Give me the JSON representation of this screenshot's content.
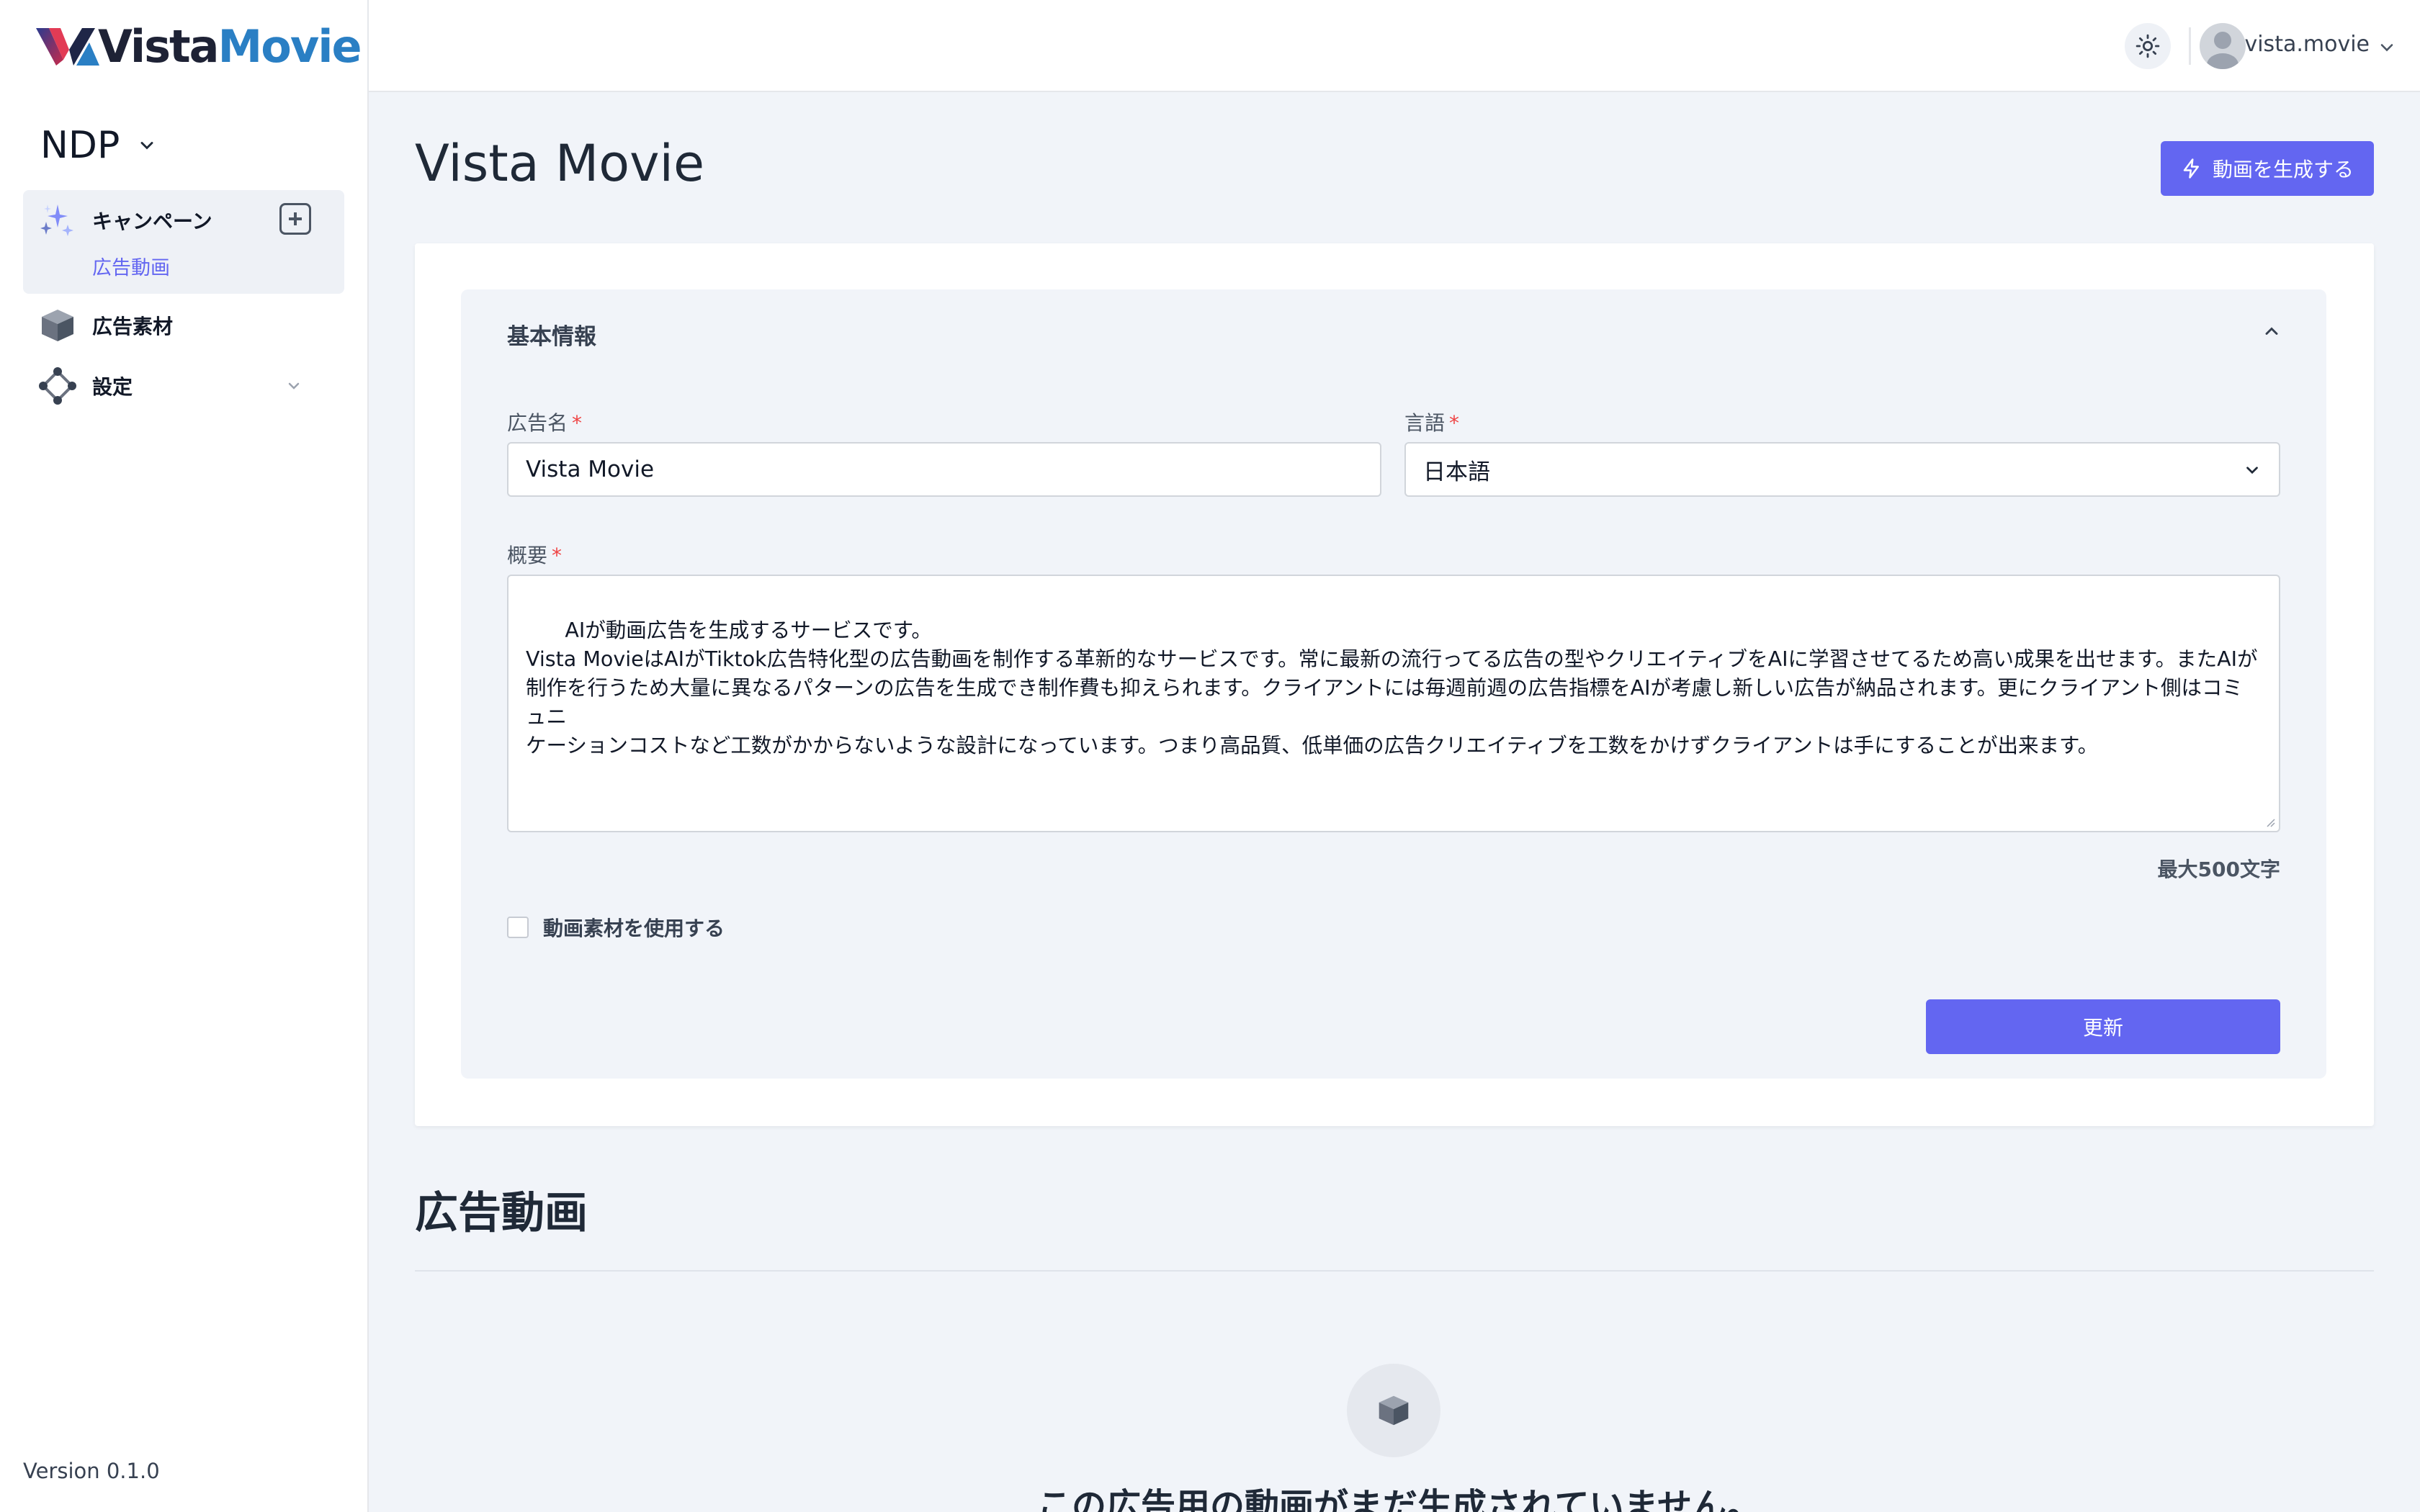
{
  "app": {
    "logo_word1": "Vista",
    "logo_word2": "Movie",
    "version": "Version 0.1.0"
  },
  "sidebar": {
    "workspace": "NDP",
    "items": [
      {
        "label": "キャンペーン",
        "icon": "sparkles-icon",
        "sub": "広告動画"
      },
      {
        "label": "広告素材",
        "icon": "cube-icon"
      },
      {
        "label": "設定",
        "icon": "settings-diamond-icon"
      }
    ]
  },
  "topbar": {
    "theme_icon": "sun-icon",
    "user": "vista.movie"
  },
  "page": {
    "title": "Vista Movie",
    "generate_button": "動画を生成する"
  },
  "form": {
    "section_title": "基本情報",
    "ad_name_label": "広告名",
    "ad_name_value": "Vista Movie",
    "language_label": "言語",
    "language_value": "日本語",
    "summary_label": "概要",
    "summary_value": "AIが動画広告を生成するサービスです。\nVista MovieはAIがTiktok広告特化型の広告動画を制作する革新的なサービスです。常に最新の流行ってる広告の型やクリエイティブをAIに学習させてるため高い成果を出せます。またAIが\n制作を行うため大量に異なるパターンの広告を生成でき制作費も抑えられます。クライアントには毎週前週の広告指標をAIが考慮し新しい広告が納品されます。更にクライアント側はコミュニ\nケーションコストなど工数がかからないような設計になっています。つまり高品質、低単価の広告クリエイティブを工数をかけずクライアントは手にすることが出来ます。",
    "max_chars": "最大500文字",
    "use_video_assets_label": "動画素材を使用する",
    "required_mark": "*",
    "update_button": "更新"
  },
  "videos": {
    "section_title": "広告動画",
    "empty_message": "この広告用の動画がまだ生成されていません。"
  },
  "colors": {
    "accent": "#6366f1",
    "logo_blue": "#2a7fc4",
    "background": "#f1f4f9"
  }
}
